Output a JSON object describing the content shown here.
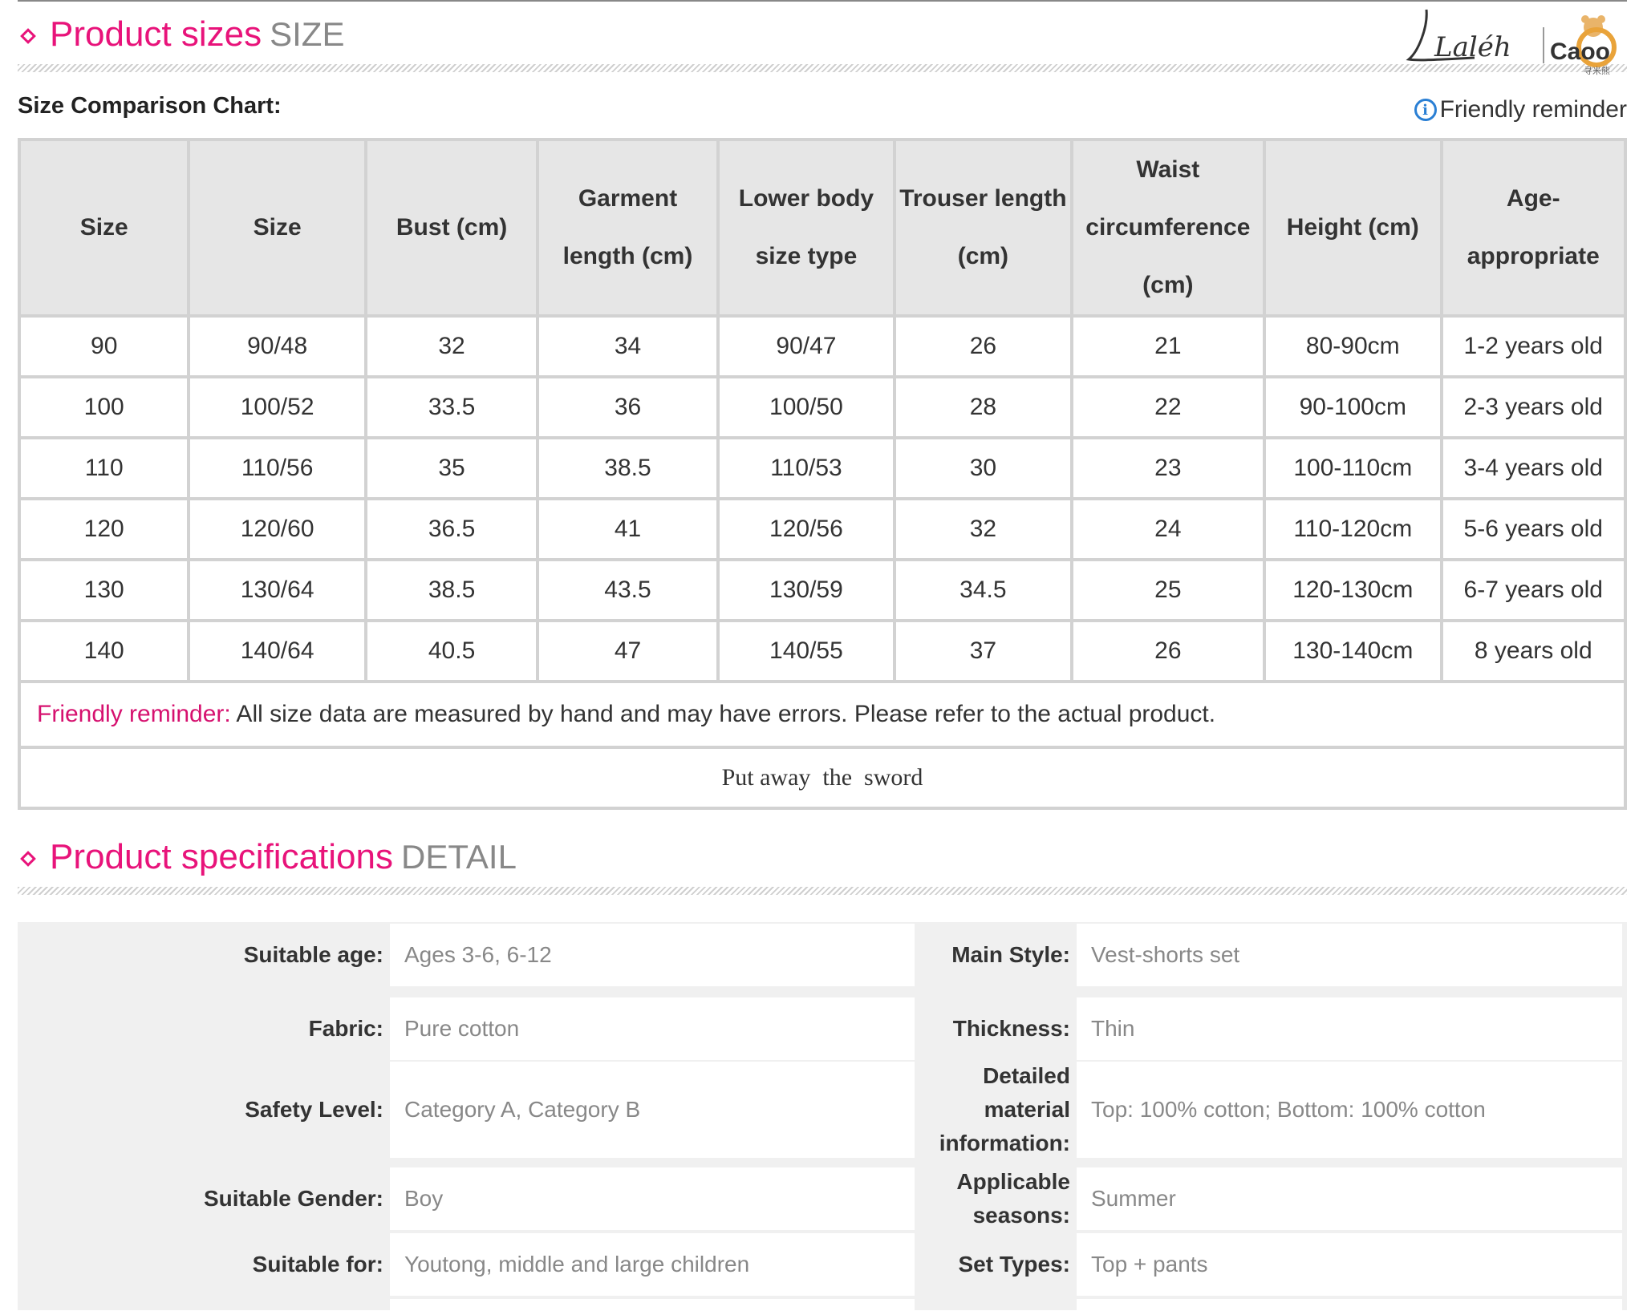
{
  "size_section": {
    "title": "Product sizes",
    "title_en": "SIZE"
  },
  "logo": {
    "brand": "Laléh",
    "brand2": "Caoo",
    "brand2_sub": "寻米熊"
  },
  "chart_label": "Size Comparison Chart:",
  "reminder_link": "Friendly reminder",
  "size_table": {
    "headers": [
      "Size",
      "Size",
      "Bust (cm)",
      "Garment length (cm)",
      "Lower body size type",
      "Trouser length (cm)",
      "Waist circumference (cm)",
      "Height (cm)",
      "Age-appropriate"
    ],
    "rows": [
      [
        "90",
        "90/48",
        "32",
        "34",
        "90/47",
        "26",
        "21",
        "80-90cm",
        "1-2 years old"
      ],
      [
        "100",
        "100/52",
        "33.5",
        "36",
        "100/50",
        "28",
        "22",
        "90-100cm",
        "2-3 years old"
      ],
      [
        "110",
        "110/56",
        "35",
        "38.5",
        "110/53",
        "30",
        "23",
        "100-110cm",
        "3-4 years old"
      ],
      [
        "120",
        "120/60",
        "36.5",
        "41",
        "120/56",
        "32",
        "24",
        "110-120cm",
        "5-6 years old"
      ],
      [
        "130",
        "130/64",
        "38.5",
        "43.5",
        "130/59",
        "34.5",
        "25",
        "120-130cm",
        "6-7 years old"
      ],
      [
        "140",
        "140/64",
        "40.5",
        "47",
        "140/55",
        "37",
        "26",
        "130-140cm",
        "8 years old"
      ]
    ],
    "note_label": "Friendly reminder:",
    "note_text": " All size data are measured by hand and may have errors. Please refer to the actual product.",
    "footer": "Put away  the  sword"
  },
  "spec_section": {
    "title": "Product specifications",
    "title_en": "DETAIL"
  },
  "specs": [
    {
      "l1": "Suitable age:",
      "v1": "Ages 3-6, 6-12",
      "l2": "Main Style:",
      "v2": "Vest-shorts set"
    },
    {
      "l1": "Fabric:",
      "v1": "Pure cotton",
      "l2": "Thickness:",
      "v2": "Thin"
    },
    {
      "l1": "Safety Level:",
      "v1": "Category A, Category B",
      "l2": "Detailed material information:",
      "v2": "Top: 100% cotton; Bottom: 100% cotton"
    },
    {
      "l1": "Suitable Gender:",
      "v1": "Boy",
      "l2": "Applicable seasons:",
      "v2": "Summer"
    },
    {
      "l1": "Suitable for:",
      "v1": "Youtong, middle and large children",
      "l2": "Set Types:",
      "v2": "Top + pants"
    }
  ]
}
